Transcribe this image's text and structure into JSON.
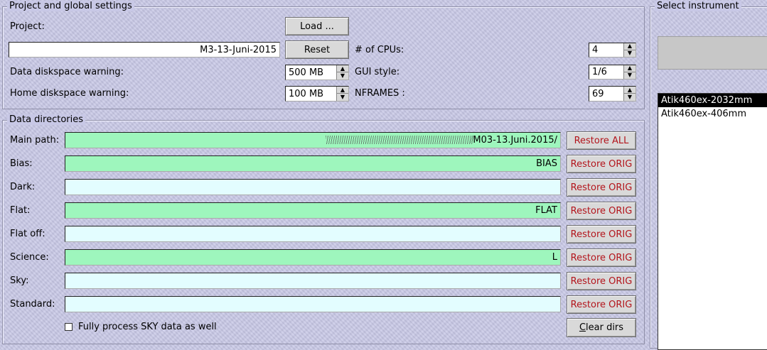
{
  "project_group": {
    "title": "Project and global settings",
    "project_label": "Project:",
    "load_label": "Load ...",
    "project_value": "M3-13-Juni-2015",
    "reset_label": "Reset",
    "cpus_label": "# of CPUs:",
    "cpus_value": "4",
    "data_disk_label": "Data diskspace warning:",
    "data_disk_value": "500 MB",
    "gui_style_label": "GUI style:",
    "gui_style_value": "1/6",
    "home_disk_label": "Home diskspace warning:",
    "home_disk_value": "100 MB",
    "nframes_label": "NFRAMES :",
    "nframes_value": "69"
  },
  "data_dirs": {
    "title": "Data directories",
    "rows": [
      {
        "label": "Main path:",
        "value": "/M03-13.Juni.2015/",
        "button": "Restore ALL",
        "color": "#9ef6bd"
      },
      {
        "label": "Bias:",
        "value": "BIAS",
        "button": "Restore ORIG",
        "color": "#9ef6bd"
      },
      {
        "label": "Dark:",
        "value": "",
        "button": "Restore ORIG",
        "color": "#e3fdff"
      },
      {
        "label": "Flat:",
        "value": "FLAT",
        "button": "Restore ORIG",
        "color": "#9ef6bd"
      },
      {
        "label": "Flat off:",
        "value": "",
        "button": "Restore ORIG",
        "color": "#e3fdff"
      },
      {
        "label": "Science:",
        "value": "L",
        "button": "Restore ORIG",
        "color": "#9ef6bd"
      },
      {
        "label": "Sky:",
        "value": "",
        "button": "Restore ORIG",
        "color": "#e3fdff"
      },
      {
        "label": "Standard:",
        "value": "",
        "button": "Restore ORIG",
        "color": "#e3fdff"
      }
    ],
    "sky_checkbox_label": "Fully process SKY data as well",
    "clear_dirs_label": "Clear dirs",
    "clear_dirs_mnemonic": "C",
    "clear_dirs_rest": "lear dirs"
  },
  "instrument": {
    "title": "Select instrument",
    "items": [
      {
        "label": "Atik460ex-2032mm",
        "selected": true
      },
      {
        "label": "Atik460ex-406mm",
        "selected": false
      }
    ]
  }
}
